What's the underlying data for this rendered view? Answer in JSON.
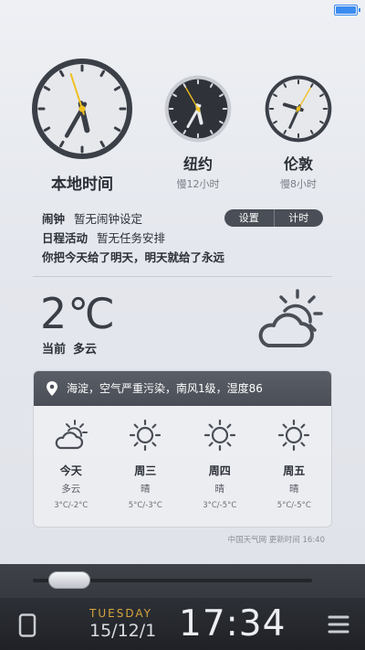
{
  "status": {
    "battery_percent": 100,
    "battery_color": "#3c8cf0"
  },
  "clocks": [
    {
      "name": "本地时间",
      "sub": "",
      "hour": 5,
      "minute": 34,
      "second": 57,
      "face": "light"
    },
    {
      "name": "纽约",
      "sub": "慢12小时",
      "hour": 5,
      "minute": 34,
      "second": 55,
      "face": "dark"
    },
    {
      "name": "伦敦",
      "sub": "慢8小时",
      "hour": 9,
      "minute": 34,
      "second": 5,
      "face": "light"
    }
  ],
  "info": {
    "alarm_label": "闹钟",
    "alarm_value": "暂无闹钟设定",
    "schedule_label": "日程活动",
    "schedule_value": "暂无任务安排",
    "quote": "你把今天给了明天，明天就给了永远",
    "settings_button": "设置",
    "timer_button": "计时"
  },
  "current": {
    "temperature": "2℃",
    "label": "当前",
    "condition": "多云",
    "icon": "sun-cloud-icon"
  },
  "location_bar": "海淀，空气严重污染，南风1级，湿度86",
  "forecast": [
    {
      "day": "今天",
      "cond": "多云",
      "range": "3°C/-2°C",
      "icon": "sun-cloud-icon"
    },
    {
      "day": "周三",
      "cond": "晴",
      "range": "5°C/-3°C",
      "icon": "sun-icon"
    },
    {
      "day": "周四",
      "cond": "晴",
      "range": "3°C/-5°C",
      "icon": "sun-icon"
    },
    {
      "day": "周五",
      "cond": "晴",
      "range": "5°C/-5°C",
      "icon": "sun-icon"
    }
  ],
  "update_text": "中国天气网 更新时间 16:40",
  "dock": {
    "weekday": "TUESDAY",
    "date": "15/12/1",
    "time": "17:34",
    "accent": "#d6a53c"
  }
}
